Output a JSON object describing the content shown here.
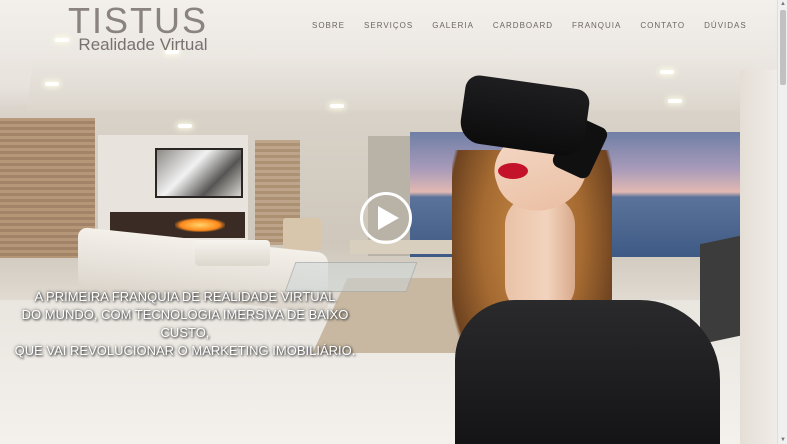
{
  "brand": {
    "title": "TISTUS",
    "subtitle": "Realidade Virtual"
  },
  "nav": {
    "items": [
      {
        "label": "SOBRE"
      },
      {
        "label": "SERVIÇOS"
      },
      {
        "label": "GALERIA"
      },
      {
        "label": "CARDBOARD"
      },
      {
        "label": "FRANQUIA"
      },
      {
        "label": "CONTATO"
      },
      {
        "label": "DÚVIDAS"
      }
    ]
  },
  "hero": {
    "tagline_line1": "A PRIMEIRA FRANQUIA DE REALIDADE VIRTUAL",
    "tagline_line2": "DO MUNDO, COM TECNOLOGIA IMERSIVA DE BAIXO CUSTO,",
    "tagline_line3": "QUE VAI REVOLUCIONAR O MARKETING IMOBILIÁRIO.",
    "play_icon": "play-icon"
  },
  "colors": {
    "nav_text": "#6c6662",
    "tagline_text": "#ffffff",
    "lips": "#c4122a"
  }
}
